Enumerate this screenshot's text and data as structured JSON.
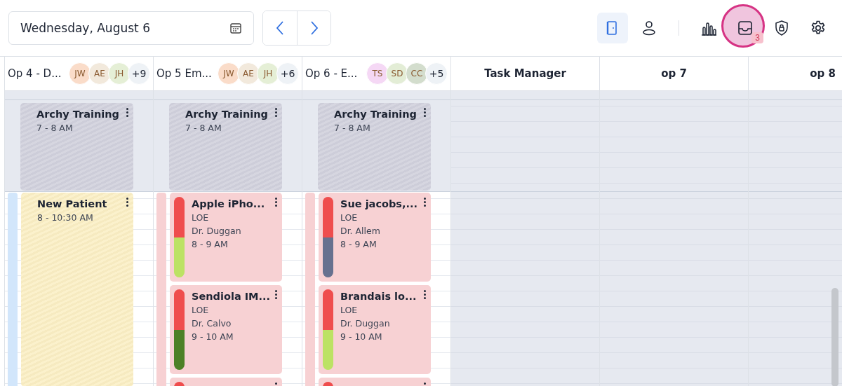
{
  "date_picker": {
    "value": "Wednesday, August 6"
  },
  "view_toggles": [
    {
      "kind": "door",
      "selected": true
    },
    {
      "kind": "person",
      "selected": false
    }
  ],
  "actions": [
    {
      "kind": "chart",
      "highlighted": false
    },
    {
      "kind": "inbox",
      "highlighted": true,
      "badge": "3"
    },
    {
      "kind": "shield",
      "highlighted": false
    },
    {
      "kind": "gear",
      "highlighted": false
    }
  ],
  "columns": [
    {
      "title": "Op 4 - D...",
      "avatars": [
        {
          "initials": "JW",
          "color": "#fadcc9"
        },
        {
          "initials": "AE",
          "color": "#f2e9dc"
        },
        {
          "initials": "JH",
          "color": "#e5efd6"
        }
      ],
      "more": "+9",
      "shaded": false,
      "strip": {
        "color": "#d2e6fb"
      },
      "events": [
        {
          "kind": "training",
          "title": "Archy Training",
          "time": "7 - 8 AM"
        },
        {
          "kind": "long",
          "title": "New Patient",
          "time": "8 - 10:30 AM"
        }
      ]
    },
    {
      "title": "Op 5 Em...",
      "avatars": [
        {
          "initials": "JW",
          "color": "#fadcc9"
        },
        {
          "initials": "AE",
          "color": "#f2e9dc"
        },
        {
          "initials": "JH",
          "color": "#e5efd6"
        }
      ],
      "more": "+6",
      "shaded": false,
      "strip": {
        "color": "#f7d1d3"
      },
      "events": [
        {
          "kind": "training",
          "title": "Archy Training",
          "time": "7 - 8 AM"
        },
        {
          "kind": "status",
          "title": "Apple iPho...",
          "type": "LOE",
          "provider": "Dr. Duggan",
          "time": "8 - 9 AM",
          "status": [
            {
              "color": "#ef4d4d"
            },
            {
              "color": "#bce264"
            }
          ]
        },
        {
          "kind": "status",
          "title": "Sendiola IM...",
          "type": "LOE",
          "provider": "Dr. Calvo",
          "time": "9 - 10 AM",
          "status": [
            {
              "color": "#ef4d4d"
            },
            {
              "color": "#4d8126"
            }
          ]
        },
        {
          "kind": "stub",
          "status": [
            {
              "color": "#ef4d4d"
            }
          ]
        }
      ]
    },
    {
      "title": "Op 6 - E...",
      "avatars": [
        {
          "initials": "TS",
          "color": "#f5d8f5"
        },
        {
          "initials": "SD",
          "color": "#e3edd6"
        },
        {
          "initials": "CC",
          "color": "#d3ddcd"
        }
      ],
      "more": "+5",
      "shaded": false,
      "strip": {
        "color": "#f7d1d3"
      },
      "events": [
        {
          "kind": "training",
          "title": "Archy Training",
          "time": "7 - 8 AM"
        },
        {
          "kind": "status",
          "title": "Sue jacobs,...",
          "type": "LOE",
          "provider": "Dr. Allem",
          "time": "8 - 9 AM",
          "status": [
            {
              "color": "#ef4d4d"
            },
            {
              "color": "#66718f"
            }
          ]
        },
        {
          "kind": "status",
          "title": "Brandais lo...",
          "type": "LOE",
          "provider": "Dr. Duggan",
          "time": "9 - 10 AM",
          "status": [
            {
              "color": "#ef4d4d"
            },
            {
              "color": "#bce264"
            }
          ]
        },
        {
          "kind": "stub",
          "status": [
            {
              "color": "#ef4d4d"
            }
          ]
        }
      ]
    },
    {
      "title": "Task Manager",
      "shaded": true
    },
    {
      "title": "op 7",
      "shaded": true
    },
    {
      "title": "op 8",
      "shaded": true
    }
  ]
}
